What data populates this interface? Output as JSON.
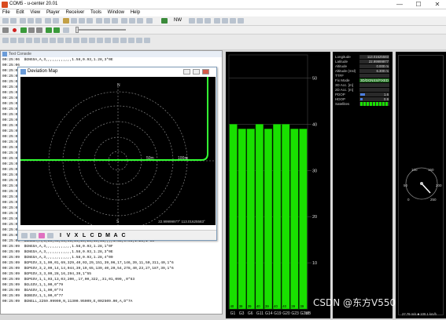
{
  "window": {
    "title": "COM5 - u-center 20.01",
    "min": "—",
    "max": "☐",
    "close": "✕"
  },
  "menu": [
    "File",
    "Edit",
    "View",
    "Player",
    "Receiver",
    "Tools",
    "Window",
    "Help"
  ],
  "toolbar": {
    "baud": "NW"
  },
  "console": {
    "title": "Text Console",
    "lines": [
      "00:25:06  $GNGSA,A,3,,,,,,,,,,,,1.58,0.93,1.28,3*0E",
      "00:25:06",
      "00:25:06",
      "00:25:06",
      "00:25:06",
      "00:25:07",
      "00:25:07",
      "00:25:07",
      "00:25:07",
      "00:25:07",
      "00:25:07",
      "00:25:07",
      "00:25:07",
      "00:25:08",
      "00:25:08",
      "00:25:08",
      "00:25:08",
      "00:25:08",
      "00:25:08",
      "00:25:08",
      "00:25:08",
      "00:25:08",
      "00:25:08",
      "00:25:08",
      "00:25:08",
      "00:25:08",
      "00:25:08",
      "00:25:08",
      "00:25:09",
      "00:25:09",
      "00:25:09",
      "00:25:09  $GNRMC,002509.00,A,2259.99999,N,11300.95909,E,4,09,0.93,6.3,M,-6.3,M,2.0",
      "00:25:09  $GNGSA,A,3,,,,,,,,,,,,1.58,0.93,1.28,1*0C",
      "00:25:09  $GNGSA,A,3,28,03,06,01,14,20,23,19,11,,,,1.58,0.93,1.28,1*0C",
      "00:25:09  $GNGSA,A,3,,,,,,,,,,,,1.58,0.93,1.28,1*0F",
      "00:25:09  $GNGSA,A,3,,,,,,,,,,,,1.58,0.93,1.28,3*0E",
      "00:25:09  $GNGSA,A,3,,,,,,,,,,,,1.58,0.93,1.28,4*09",
      "00:25:09  $GPGSV,3,1,09,01,69,329,40,03,29,151,39,06,17,146,39,11,50,311,40,1*6",
      "00:25:09  $GPGSV,3,2,09,14,14,044,39,19,65,139,40,20,54,278,40,23,27,187,39,1*6",
      "00:25:09  $GPGSV,3,3,09,28,16,294,39,1*55",
      "00:25:09  $GPGSV,1,1,03,13,03,200,,17,00,322,,31,01,099,,0*53",
      "00:25:09  $GLGSV,1,1,00,0*79",
      "00:25:09  $GAGSV,1,1,00,0*74",
      "00:25:09  $GBGSV,1,1,00,0*77",
      "00:25:09  $GNGLL,2259.99999,N,11300.95909,E,002509.00,A,D*7A"
    ]
  },
  "deviation_map": {
    "title": "Deviation Map",
    "north": "N",
    "east": "E",
    "south": "S",
    "ring_label_50": "50m",
    "ring_label_100": "100m",
    "coords": "22.99999977° 113.01625583°",
    "buttons": [
      "I",
      "V",
      "X",
      "L",
      "C",
      "D",
      "M",
      "A",
      "C"
    ]
  },
  "sky_chart": {
    "y_ticks": [
      "50",
      "40",
      "30",
      "20",
      "10"
    ],
    "satellites": [
      "G1",
      "G3",
      "G6",
      "G11",
      "G14",
      "G19",
      "G20",
      "G23",
      "G28"
    ],
    "cn0": [
      40,
      39,
      39,
      40,
      39,
      40,
      40,
      39,
      39
    ],
    "bar_labels": [
      "40",
      "39",
      "39",
      "40",
      "39",
      "40",
      "40",
      "39",
      "39"
    ],
    "unit": "dB"
  },
  "data_panel": {
    "rows": [
      {
        "label": "Longitude",
        "value": "113.01625583"
      },
      {
        "label": "Latitude",
        "value": "22.99999977"
      },
      {
        "label": "Altitude",
        "value": "0.000 m"
      },
      {
        "label": "Altitude (msl)",
        "value": "6.300 m"
      },
      {
        "label": "TTFF",
        "value": ""
      },
      {
        "label": "Fix Mode",
        "value": "3D/DGNSS/FIXED"
      },
      {
        "label": "3D Acc. [m]",
        "value": ""
      },
      {
        "label": "2D Acc. [m]",
        "value": ""
      },
      {
        "label": "PDOP",
        "value": "1.6"
      },
      {
        "label": "HDOP",
        "value": "0.9"
      },
      {
        "label": "Satellites",
        "value": ""
      }
    ],
    "pdop_level": 0.16,
    "hdop_level": 0.09,
    "satellite_count": 9
  },
  "gauge": {
    "ticks": [
      "0",
      "50",
      "100",
      "150",
      "200",
      "250"
    ],
    "speed_readout": "27.79 m/s ■ 100.1 km/h"
  },
  "watermark": "CSDN @东方V550",
  "colors": {
    "accent_green": "#19e000",
    "map_track": "#33ff33"
  }
}
